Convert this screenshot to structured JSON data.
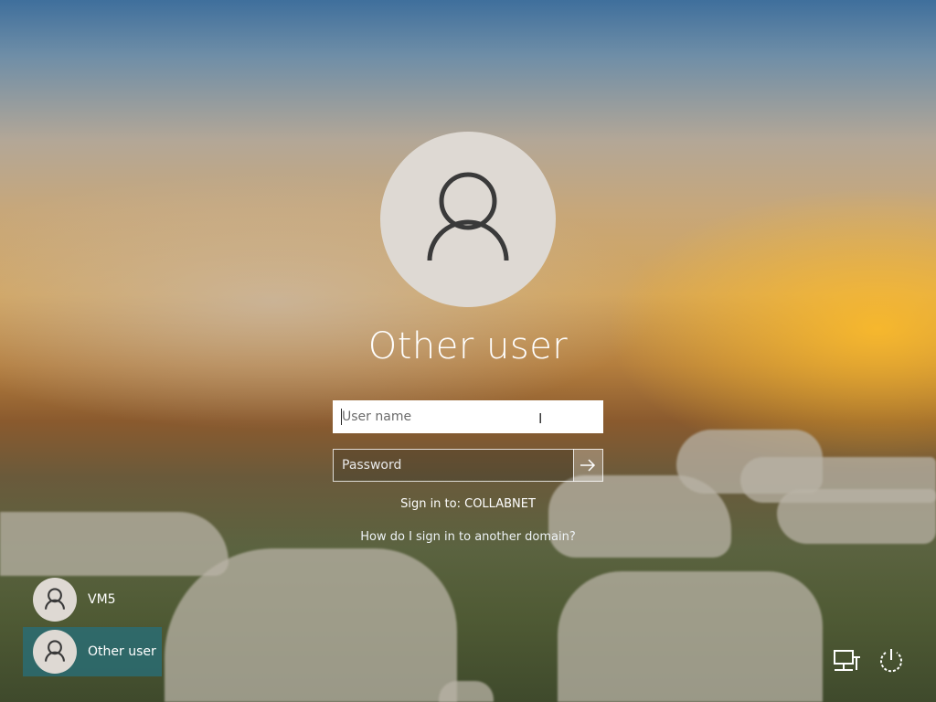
{
  "login": {
    "title": "Other user",
    "username_placeholder": "User name",
    "password_placeholder": "Password",
    "signin_to": "Sign in to: COLLABNET",
    "other_domain_link": "How do I sign in to another domain?"
  },
  "accounts": [
    {
      "name": "VM5",
      "selected": false
    },
    {
      "name": "Other user",
      "selected": true
    }
  ],
  "icons": {
    "avatar": "user-avatar-icon",
    "submit": "arrow-right-icon",
    "network": "network-icon",
    "power": "power-icon"
  },
  "colors": {
    "selected_account_bg": "#2b6e78",
    "avatar_bg": "#ded9d3",
    "avatar_glyph": "#3a3a3a"
  }
}
